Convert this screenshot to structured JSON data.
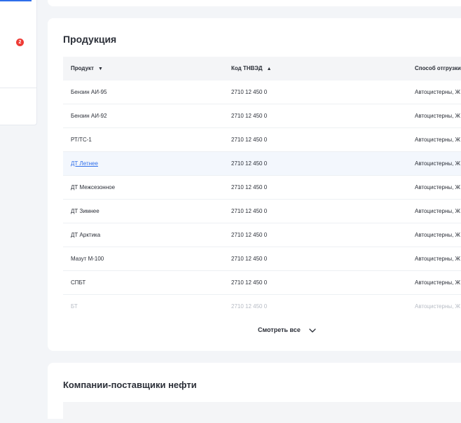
{
  "sidebar": {
    "badge_count": "2"
  },
  "products": {
    "title": "Продукция",
    "columns": [
      {
        "label": "Продукт",
        "sort": "desc"
      },
      {
        "label": "Код ТНВЭД",
        "sort": "asc"
      },
      {
        "label": "Способ отгрузки"
      }
    ],
    "rows": [
      {
        "product": "Бензин АИ-95",
        "code": "2710 12 450 0",
        "shipping": "Автоцистерны, Ж"
      },
      {
        "product": "Бензин АИ-92",
        "code": "2710 12 450 0",
        "shipping": "Автоцистерны, Ж"
      },
      {
        "product": "РТ/ТС-1",
        "code": "2710 12 450 0",
        "shipping": "Автоцистерны, Ж"
      },
      {
        "product": "ДТ Летнее",
        "code": "2710 12 450 0",
        "shipping": "Автоцистерны, Ж"
      },
      {
        "product": "ДТ Межсезонное",
        "code": "2710 12 450 0",
        "shipping": "Автоцистерны, Ж"
      },
      {
        "product": "ДТ Зимнее",
        "code": "2710 12 450 0",
        "shipping": "Автоцистерны, Ж"
      },
      {
        "product": "ДТ Арктика",
        "code": "2710 12 450 0",
        "shipping": "Автоцистерны, Ж"
      },
      {
        "product": "Мазут М-100",
        "code": "2710 12 450 0",
        "shipping": "Автоцистерны, Ж"
      },
      {
        "product": "СПБТ",
        "code": "2710 12 450 0",
        "shipping": "Автоцистерны, Ж"
      },
      {
        "product": "БТ",
        "code": "2710 12 450 0",
        "shipping": "Автоцистерны, Ж"
      }
    ],
    "view_all_label": "Смотреть все"
  },
  "suppliers": {
    "title": "Компании-поставщики нефти"
  },
  "colors": {
    "accent": "#2f6fea",
    "badge": "#ee3b35"
  },
  "icons": {
    "sort_desc": "caret-down-icon",
    "sort_asc": "caret-up-icon",
    "view_all": "chevron-down-icon"
  }
}
